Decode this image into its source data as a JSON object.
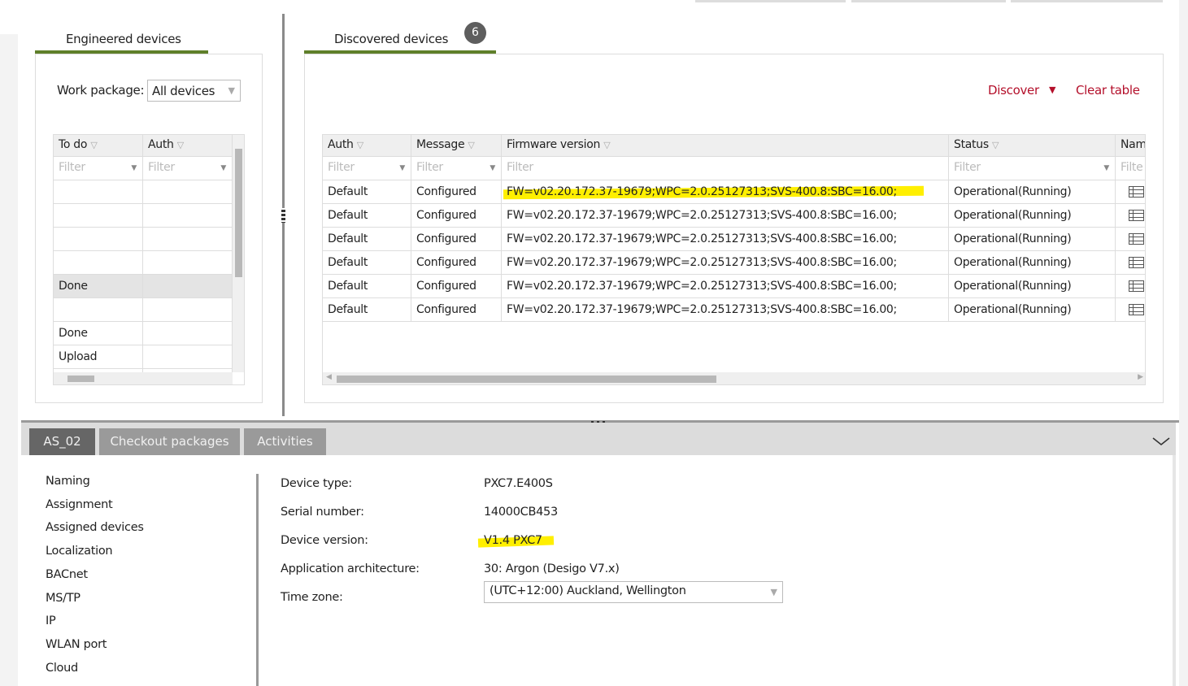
{
  "engineered": {
    "tab_label": "Engineered devices",
    "work_package_label": "Work package:",
    "work_package_value": "All devices",
    "columns": [
      "To do",
      "Auth"
    ],
    "filter_placeholder": "Filter",
    "rows": [
      {
        "todo": "",
        "auth": ""
      },
      {
        "todo": "",
        "auth": ""
      },
      {
        "todo": "",
        "auth": ""
      },
      {
        "todo": "",
        "auth": ""
      },
      {
        "todo": "Done",
        "auth": "",
        "selected": true
      },
      {
        "todo": "",
        "auth": ""
      },
      {
        "todo": "Done",
        "auth": ""
      },
      {
        "todo": "Upload",
        "auth": ""
      },
      {
        "todo": "",
        "auth": ""
      }
    ]
  },
  "discovered": {
    "tab_label": "Discovered devices",
    "count": "6",
    "discover_label": "Discover",
    "clear_label": "Clear table",
    "columns": [
      "Auth",
      "Message",
      "Firmware version",
      "Status",
      "Nam"
    ],
    "filter_placeholder": "Filter",
    "filter_partial": "Filte",
    "rows": [
      {
        "auth": "Default",
        "message": "Configured",
        "firmware": "FW=v02.20.172.37-19679;WPC=2.0.25127313;SVS-400.8:SBC=16.00;",
        "status": "Operational(Running)",
        "highlight": true
      },
      {
        "auth": "Default",
        "message": "Configured",
        "firmware": "FW=v02.20.172.37-19679;WPC=2.0.25127313;SVS-400.8:SBC=16.00;",
        "status": "Operational(Running)"
      },
      {
        "auth": "Default",
        "message": "Configured",
        "firmware": "FW=v02.20.172.37-19679;WPC=2.0.25127313;SVS-400.8:SBC=16.00;",
        "status": "Operational(Running)"
      },
      {
        "auth": "Default",
        "message": "Configured",
        "firmware": "FW=v02.20.172.37-19679;WPC=2.0.25127313;SVS-400.8:SBC=16.00;",
        "status": "Operational(Running)"
      },
      {
        "auth": "Default",
        "message": "Configured",
        "firmware": "FW=v02.20.172.37-19679;WPC=2.0.25127313;SVS-400.8:SBC=16.00;",
        "status": "Operational(Running)"
      },
      {
        "auth": "Default",
        "message": "Configured",
        "firmware": "FW=v02.20.172.37-19679;WPC=2.0.25127313;SVS-400.8:SBC=16.00;",
        "status": "Operational(Running)"
      }
    ]
  },
  "bottom": {
    "tabs": [
      "AS_02",
      "Checkout packages",
      "Activities"
    ],
    "active_tab": 0,
    "nav": [
      "Naming",
      "Assignment",
      "Assigned devices",
      "Localization",
      "BACnet",
      "MS/TP",
      "IP",
      "WLAN port",
      "Cloud"
    ],
    "fields": [
      {
        "label": "Device type:",
        "value": "PXC7.E400S"
      },
      {
        "label": "Serial number:",
        "value": "14000CB453"
      },
      {
        "label": "Device version:",
        "value": "V1.4 PXC7",
        "highlight": true
      },
      {
        "label": "Application architecture:",
        "value": "30: Argon (Desigo V7.x)"
      },
      {
        "label": "Time zone:",
        "value": "(UTC+12:00) Auckland, Wellington",
        "type": "select"
      }
    ]
  },
  "colors": {
    "accent_green": "#5f7f2a",
    "action_red": "#b4102b",
    "highlight": "#ffef00"
  }
}
